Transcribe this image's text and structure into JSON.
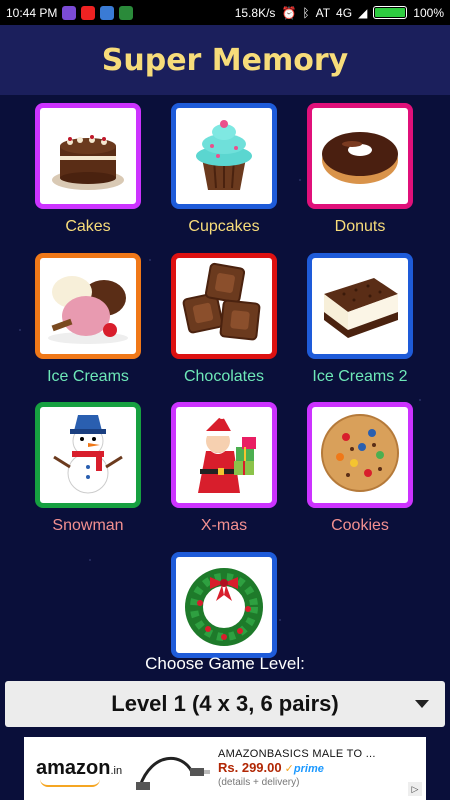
{
  "status": {
    "time": "10:44 PM",
    "speed": "15.8K/s",
    "carrier": "AT",
    "network": "4G",
    "battery": "100%"
  },
  "app": {
    "title": "Super Memory"
  },
  "categories": [
    {
      "label": "Cakes",
      "icon": "cake-icon",
      "border": "#cc33ff",
      "label_color": "#f7dc7a"
    },
    {
      "label": "Cupcakes",
      "icon": "cupcake-icon",
      "border": "#1e5bd9",
      "label_color": "#f7dc7a"
    },
    {
      "label": "Donuts",
      "icon": "donut-icon",
      "border": "#e0107a",
      "label_color": "#f7dc7a"
    },
    {
      "label": "Ice Creams",
      "icon": "ice-cream-icon",
      "border": "#f07818",
      "label_color": "#6ee8b8"
    },
    {
      "label": "Chocolates",
      "icon": "chocolate-icon",
      "border": "#dd1111",
      "label_color": "#6ee8b8"
    },
    {
      "label": "Ice Creams 2",
      "icon": "ice-cream-sandwich-icon",
      "border": "#1e5bd9",
      "label_color": "#6ee8b8"
    },
    {
      "label": "Snowman",
      "icon": "snowman-icon",
      "border": "#16a040",
      "label_color": "#f39090"
    },
    {
      "label": "X-mas",
      "icon": "santa-icon",
      "border": "#cc33ff",
      "label_color": "#f39090"
    },
    {
      "label": "Cookies",
      "icon": "cookie-icon",
      "border": "#cc33ff",
      "label_color": "#f39090"
    },
    {
      "label": "",
      "icon": "wreath-icon",
      "border": "#1e5bd9",
      "label_color": "#f39090"
    }
  ],
  "level": {
    "caption": "Choose Game Level:",
    "selected": "Level 1 (4 x 3, 6 pairs)"
  },
  "ad": {
    "brand": "amazon",
    "brand_suffix": ".in",
    "product": "AMAZONBASICS MALE TO ...",
    "price": "Rs. 299.00",
    "prime": "prime",
    "sub": "(details + delivery)"
  }
}
